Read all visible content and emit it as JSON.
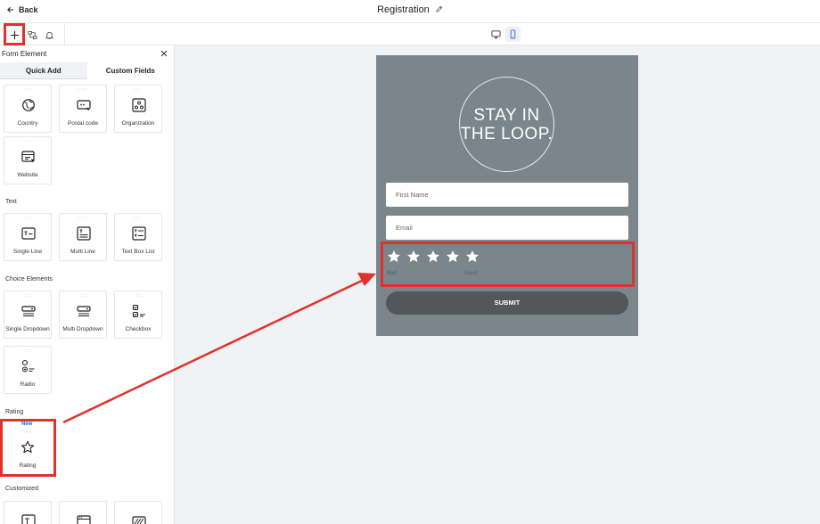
{
  "header": {
    "back_label": "Back",
    "title": "Registration"
  },
  "toolbar": {
    "tools": [
      "plus-icon",
      "layers-icon",
      "bell-icon"
    ],
    "devices": [
      "desktop-icon",
      "mobile-icon"
    ],
    "active_device": "mobile"
  },
  "panel": {
    "title": "Form Element",
    "tabs": [
      {
        "label": "Quick Add",
        "active": true
      },
      {
        "label": "Custom Fields",
        "active": false
      }
    ],
    "sections": {
      "text": "Text",
      "choice": "Choice Elements",
      "rating": "Rating",
      "customized": "Customized"
    },
    "items": {
      "country": "Country",
      "postal_code": "Postal code",
      "organization": "Organization",
      "website": "Website",
      "single_line": "Single Line",
      "multi_line": "Multi Line",
      "text_box_list": "Text Box List",
      "single_dropdown": "Single Dropdown",
      "multi_dropdown": "Multi Dropdown",
      "checkbox": "Checkbox",
      "radio": "Radio",
      "rating": "Rating"
    },
    "new_badge": "New"
  },
  "form": {
    "headline_line1": "STAY IN",
    "headline_line2": "THE LOOP.",
    "first_name_placeholder": "First Name",
    "email_placeholder": "Email",
    "star_count": 5,
    "rating_low": "Bad",
    "rating_high": "Good",
    "submit_label": "SUBMIT",
    "bg_color": "#7b868c"
  },
  "colors": {
    "highlight": "#e0322c",
    "accent": "#2563eb"
  }
}
